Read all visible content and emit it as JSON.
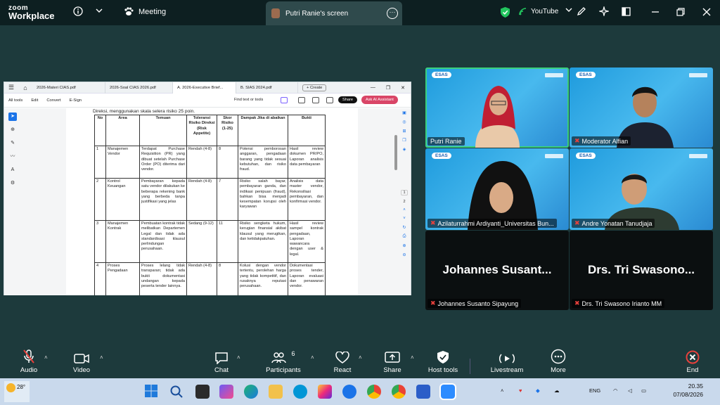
{
  "app": {
    "logo_line1": "zoom",
    "logo_line2": "Workplace"
  },
  "topbar": {
    "meeting_label": "Meeting",
    "share_tab_label": "Putri Ranie's screen",
    "youtube_label": "YouTube"
  },
  "document": {
    "tabs": [
      "2026-Materi CIAS.pdf",
      "2026-Soal CIAS 2026.pdf",
      "A. 2026-Executive Brief...",
      "B. SIAS 2024.pdf"
    ],
    "create_label": "+ Create",
    "menu": [
      "All tools",
      "Edit",
      "Convert",
      "E-Sign"
    ],
    "find_label": "Find text or tools",
    "share_label": "Share",
    "ai_label": "Ask AI Assistant",
    "page_numbers": [
      "1",
      "2"
    ],
    "intro_text": "Direksi, menggunakan skala selera risiko 25 poin.",
    "table_headers": [
      "No",
      "Area",
      "Temuan",
      "Toleransi Risiko Direksi (Risk Appetite)",
      "Skor Risiko (1-25)",
      "Dampak Jika di abaikan",
      "Bukti"
    ],
    "rows": [
      {
        "no": "1",
        "area": "Manajemen Vendor",
        "temuan": "Terdapat Purchase Requisition (PR) yang dibuat setelah Purchase Order (PO) diterima dari vendor.",
        "toleransi": "Rendah (4-8)",
        "skor": "8",
        "dampak": "Potensi pemborosan anggaran, pengadaan barang yang tidak sesuai kebutuhan, dan risiko fraud.",
        "bukti": "Hasil review dokumen PR/PO, Laporan analisis data pembayaran"
      },
      {
        "no": "2",
        "area": "Kontrol Keuangan",
        "temuan": "Pembayaran kepada satu vendor dilakukan ke beberapa rekening bank yang berbeda tanpa justifikasi yang jelas",
        "toleransi": "Rendah (4-8)",
        "skor": "7",
        "dampak": "Risiko salah bayar, pembayaran ganda, dan indikasi penipuan (fraud), bahkan bisa menjadi kesempatan korupsi oleh karyawan",
        "bukti": "Analisis data master vendor, Rekonsiliasi pembayaran, dan konfirmasi vendor."
      },
      {
        "no": "3",
        "area": "Manajemen Kontrak",
        "temuan": "Pembuatan kontrak tidak melibatkan Departemen Legal dan tidak ada standardisasi klausul perlindungan perusahaan.",
        "toleransi": "Sedang (9-12)",
        "skor": "11",
        "dampak": "Risiko sengketa hukum, kerugian finansial akibat klausul yang merugikan, dan ketidakpatuhan.",
        "bukti": "Hasil review sampel kontrak pengadaan, Laporan wawancara dengan user & legal."
      },
      {
        "no": "4",
        "area": "Proses Pengadaan",
        "temuan": "Proses lelang tidak transparan; tidak ada bukti dokumentasi undangan kepada peserta tender lainnya.",
        "toleransi": "Rendah (4-8)",
        "skor": "8",
        "dampak": "Kolusi dengan vendor tertentu, perolehan harga yang tidak kompetitif, dan rusaknya reputasi perusahaan.",
        "bukti": "Dokumentasi proses tender, Laporan evaluasi dan penawaran vendor."
      }
    ]
  },
  "participants": [
    {
      "name": "Putri Ranie",
      "muted": false,
      "video": true,
      "active": true,
      "brand": "ESAS"
    },
    {
      "name": "Moderator Alfian",
      "muted": true,
      "video": true,
      "brand": "ESAS"
    },
    {
      "name": "Azilaturrahmi Ardiyanti_Universitas Bun...",
      "muted": true,
      "video": true,
      "brand": "ESAS"
    },
    {
      "name": "Andre Yonatan Tanudjaja",
      "muted": true,
      "video": true,
      "brand": "ESAS"
    },
    {
      "name": "Johannes Susanto Sipayung",
      "muted": true,
      "video": false,
      "big_label": "Johannes Susant..."
    },
    {
      "name": "Drs. Tri Swasono Irianto MM",
      "muted": true,
      "video": false,
      "big_label": "Drs. Tri Swasono..."
    }
  ],
  "toolbar": {
    "audio": "Audio",
    "video": "Video",
    "chat": "Chat",
    "participants": "Participants",
    "participants_count": "6",
    "react": "React",
    "share": "Share",
    "host_tools": "Host tools",
    "livestream": "Livestream",
    "more": "More",
    "end": "End"
  },
  "taskbar": {
    "temperature": "28°",
    "lang": "ENG",
    "time": "20.35",
    "date": "07/08/2026"
  },
  "colors": {
    "zoom_bg": "#1d3a3c",
    "active_speaker": "#3ad07c",
    "end": "#e8413c",
    "ai_button": "#d94567"
  }
}
